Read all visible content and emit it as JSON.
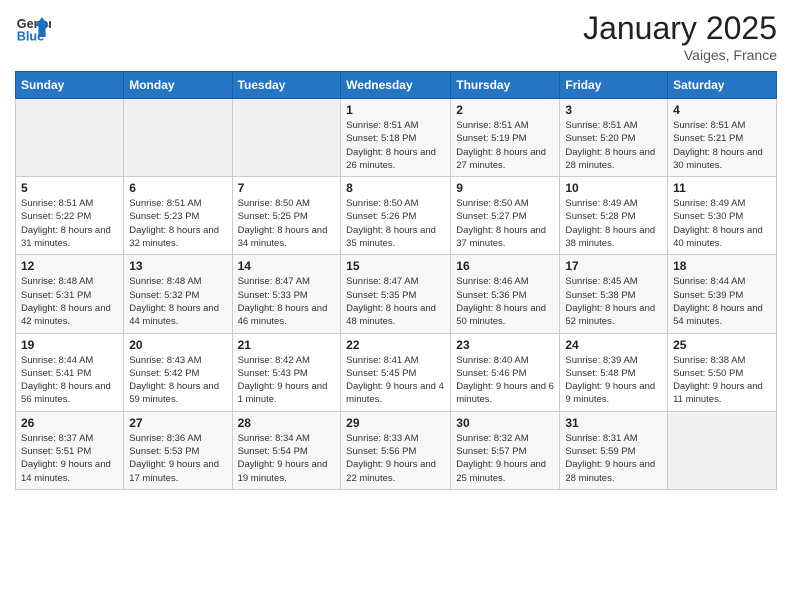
{
  "header": {
    "logo_general": "General",
    "logo_blue": "Blue",
    "month_title": "January 2025",
    "location": "Vaiges, France"
  },
  "weekdays": [
    "Sunday",
    "Monday",
    "Tuesday",
    "Wednesday",
    "Thursday",
    "Friday",
    "Saturday"
  ],
  "weeks": [
    [
      {
        "day": "",
        "info": ""
      },
      {
        "day": "",
        "info": ""
      },
      {
        "day": "",
        "info": ""
      },
      {
        "day": "1",
        "info": "Sunrise: 8:51 AM\nSunset: 5:18 PM\nDaylight: 8 hours and 26 minutes."
      },
      {
        "day": "2",
        "info": "Sunrise: 8:51 AM\nSunset: 5:19 PM\nDaylight: 8 hours and 27 minutes."
      },
      {
        "day": "3",
        "info": "Sunrise: 8:51 AM\nSunset: 5:20 PM\nDaylight: 8 hours and 28 minutes."
      },
      {
        "day": "4",
        "info": "Sunrise: 8:51 AM\nSunset: 5:21 PM\nDaylight: 8 hours and 30 minutes."
      }
    ],
    [
      {
        "day": "5",
        "info": "Sunrise: 8:51 AM\nSunset: 5:22 PM\nDaylight: 8 hours and 31 minutes."
      },
      {
        "day": "6",
        "info": "Sunrise: 8:51 AM\nSunset: 5:23 PM\nDaylight: 8 hours and 32 minutes."
      },
      {
        "day": "7",
        "info": "Sunrise: 8:50 AM\nSunset: 5:25 PM\nDaylight: 8 hours and 34 minutes."
      },
      {
        "day": "8",
        "info": "Sunrise: 8:50 AM\nSunset: 5:26 PM\nDaylight: 8 hours and 35 minutes."
      },
      {
        "day": "9",
        "info": "Sunrise: 8:50 AM\nSunset: 5:27 PM\nDaylight: 8 hours and 37 minutes."
      },
      {
        "day": "10",
        "info": "Sunrise: 8:49 AM\nSunset: 5:28 PM\nDaylight: 8 hours and 38 minutes."
      },
      {
        "day": "11",
        "info": "Sunrise: 8:49 AM\nSunset: 5:30 PM\nDaylight: 8 hours and 40 minutes."
      }
    ],
    [
      {
        "day": "12",
        "info": "Sunrise: 8:48 AM\nSunset: 5:31 PM\nDaylight: 8 hours and 42 minutes."
      },
      {
        "day": "13",
        "info": "Sunrise: 8:48 AM\nSunset: 5:32 PM\nDaylight: 8 hours and 44 minutes."
      },
      {
        "day": "14",
        "info": "Sunrise: 8:47 AM\nSunset: 5:33 PM\nDaylight: 8 hours and 46 minutes."
      },
      {
        "day": "15",
        "info": "Sunrise: 8:47 AM\nSunset: 5:35 PM\nDaylight: 8 hours and 48 minutes."
      },
      {
        "day": "16",
        "info": "Sunrise: 8:46 AM\nSunset: 5:36 PM\nDaylight: 8 hours and 50 minutes."
      },
      {
        "day": "17",
        "info": "Sunrise: 8:45 AM\nSunset: 5:38 PM\nDaylight: 8 hours and 52 minutes."
      },
      {
        "day": "18",
        "info": "Sunrise: 8:44 AM\nSunset: 5:39 PM\nDaylight: 8 hours and 54 minutes."
      }
    ],
    [
      {
        "day": "19",
        "info": "Sunrise: 8:44 AM\nSunset: 5:41 PM\nDaylight: 8 hours and 56 minutes."
      },
      {
        "day": "20",
        "info": "Sunrise: 8:43 AM\nSunset: 5:42 PM\nDaylight: 8 hours and 59 minutes."
      },
      {
        "day": "21",
        "info": "Sunrise: 8:42 AM\nSunset: 5:43 PM\nDaylight: 9 hours and 1 minute."
      },
      {
        "day": "22",
        "info": "Sunrise: 8:41 AM\nSunset: 5:45 PM\nDaylight: 9 hours and 4 minutes."
      },
      {
        "day": "23",
        "info": "Sunrise: 8:40 AM\nSunset: 5:46 PM\nDaylight: 9 hours and 6 minutes."
      },
      {
        "day": "24",
        "info": "Sunrise: 8:39 AM\nSunset: 5:48 PM\nDaylight: 9 hours and 9 minutes."
      },
      {
        "day": "25",
        "info": "Sunrise: 8:38 AM\nSunset: 5:50 PM\nDaylight: 9 hours and 11 minutes."
      }
    ],
    [
      {
        "day": "26",
        "info": "Sunrise: 8:37 AM\nSunset: 5:51 PM\nDaylight: 9 hours and 14 minutes."
      },
      {
        "day": "27",
        "info": "Sunrise: 8:36 AM\nSunset: 5:53 PM\nDaylight: 9 hours and 17 minutes."
      },
      {
        "day": "28",
        "info": "Sunrise: 8:34 AM\nSunset: 5:54 PM\nDaylight: 9 hours and 19 minutes."
      },
      {
        "day": "29",
        "info": "Sunrise: 8:33 AM\nSunset: 5:56 PM\nDaylight: 9 hours and 22 minutes."
      },
      {
        "day": "30",
        "info": "Sunrise: 8:32 AM\nSunset: 5:57 PM\nDaylight: 9 hours and 25 minutes."
      },
      {
        "day": "31",
        "info": "Sunrise: 8:31 AM\nSunset: 5:59 PM\nDaylight: 9 hours and 28 minutes."
      },
      {
        "day": "",
        "info": ""
      }
    ]
  ]
}
